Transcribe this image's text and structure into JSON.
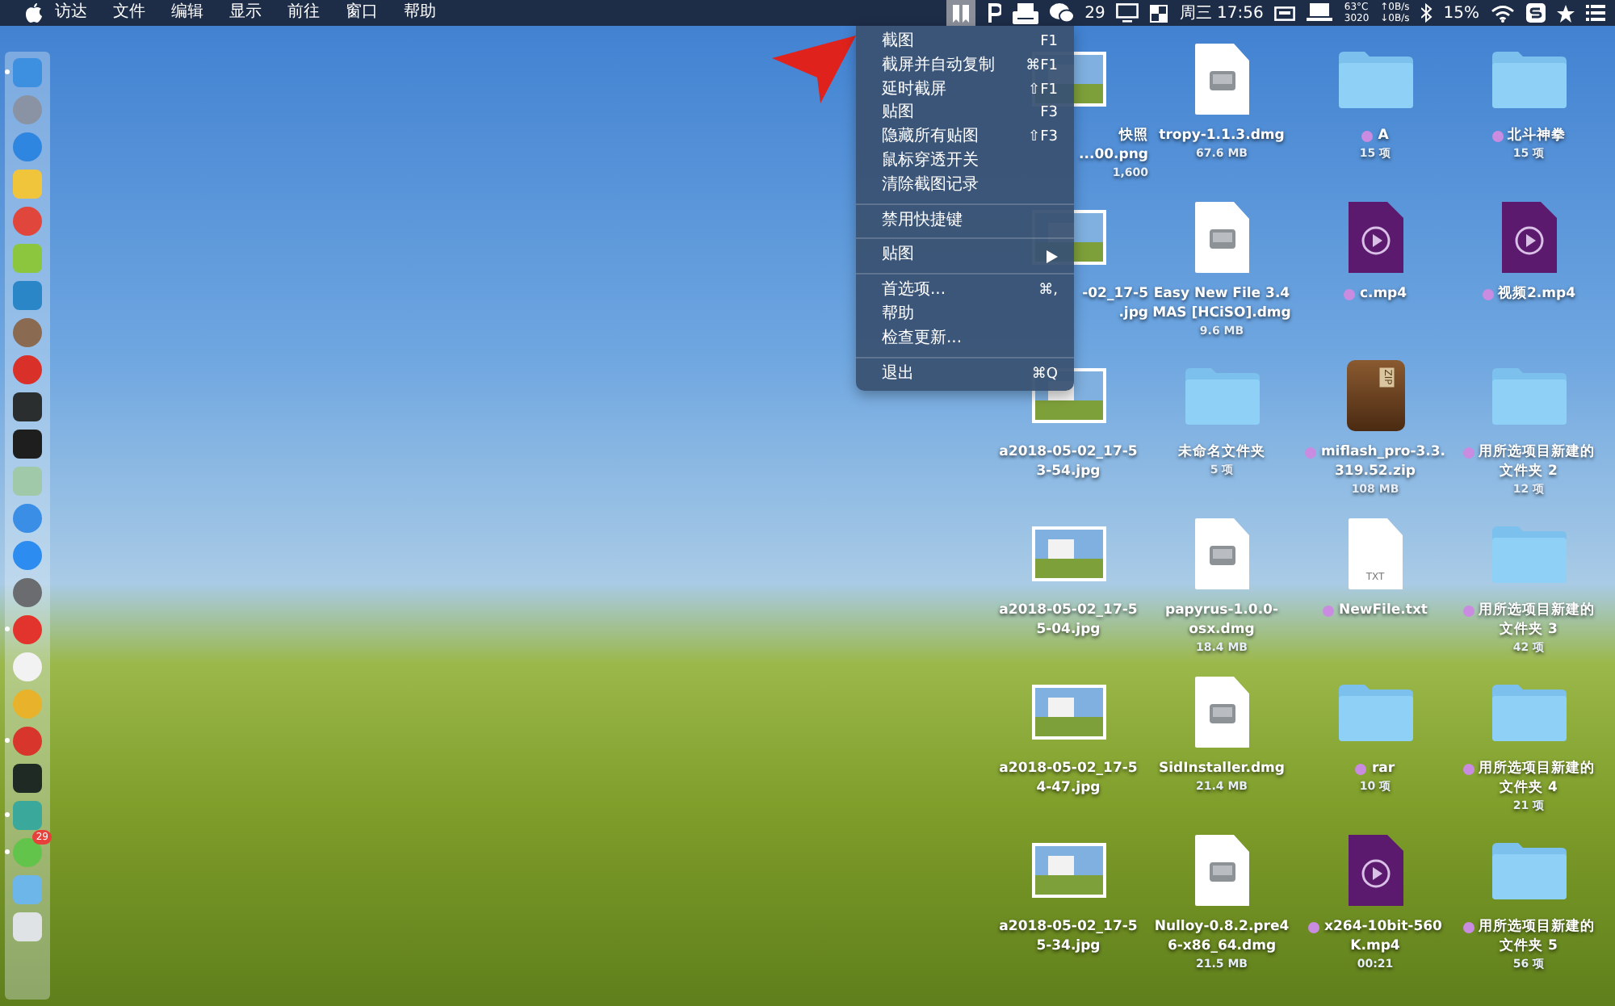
{
  "menubar": {
    "menus": [
      "访达",
      "文件",
      "编辑",
      "显示",
      "前往",
      "窗口",
      "帮助"
    ],
    "screenshot_extra_selected": true,
    "wechat_count": "29",
    "clock": "周三 17:56",
    "sensors": [
      "63°C",
      "3020"
    ],
    "network": [
      "↑0B/s",
      "↓0B/s"
    ],
    "battery": "15%"
  },
  "menu": {
    "sections": [
      [
        {
          "label": "截图",
          "shortcut": "F1",
          "submenu": false
        },
        {
          "label": "截屏并自动复制",
          "shortcut": "⌘F1",
          "submenu": false
        },
        {
          "label": "延时截屏",
          "shortcut": "⇧F1",
          "submenu": false
        },
        {
          "label": "贴图",
          "shortcut": "F3",
          "submenu": false
        },
        {
          "label": "隐藏所有贴图",
          "shortcut": "⇧F3",
          "submenu": false
        },
        {
          "label": "鼠标穿透开关",
          "submenu": false
        },
        {
          "label": "清除截图记录",
          "submenu": false
        }
      ],
      [
        {
          "label": "禁用快捷键",
          "submenu": false
        }
      ],
      [
        {
          "label": "贴图",
          "submenu": true
        }
      ],
      [
        {
          "label": "首选项...",
          "shortcut": "⌘,",
          "submenu": false
        },
        {
          "label": "帮助",
          "submenu": false
        },
        {
          "label": "检查更新...",
          "submenu": false
        }
      ],
      [
        {
          "label": "退出",
          "shortcut": "⌘Q",
          "submenu": false
        }
      ]
    ]
  },
  "dock": [
    {
      "kind": "square",
      "color": "#3d8fe0",
      "running": true
    },
    {
      "kind": "circle",
      "color": "#8a93a3",
      "running": false
    },
    {
      "kind": "circle",
      "color": "#2f86e0",
      "running": false
    },
    {
      "kind": "square",
      "color": "#f0c53c",
      "running": false
    },
    {
      "kind": "circle",
      "color": "#e0463c",
      "running": false
    },
    {
      "kind": "square",
      "color": "#8cc63f",
      "running": false
    },
    {
      "kind": "square",
      "color": "#2b86c8",
      "running": false
    },
    {
      "kind": "circle",
      "color": "#8a6a50",
      "running": false
    },
    {
      "kind": "circle",
      "color": "#d9302a",
      "running": false
    },
    {
      "kind": "square",
      "color": "#2a2e2e",
      "running": false
    },
    {
      "kind": "square",
      "color": "#1e1e1e",
      "running": false
    },
    {
      "kind": "square",
      "color": "#9fc9a8",
      "running": false
    },
    {
      "kind": "circle",
      "color": "#3a8ee6",
      "running": false
    },
    {
      "kind": "circle",
      "color": "#2d8cf0",
      "running": false
    },
    {
      "kind": "circle",
      "color": "#6a6c70",
      "running": false
    },
    {
      "kind": "circle",
      "color": "#e2342c",
      "running": true
    },
    {
      "kind": "circle",
      "color": "#f2f2f2",
      "running": false
    },
    {
      "kind": "circle",
      "color": "#e8b32a",
      "running": false
    },
    {
      "kind": "circle",
      "color": "#d8352c",
      "running": true
    },
    {
      "kind": "square",
      "color": "#1f2a24",
      "running": false
    },
    {
      "kind": "square",
      "color": "#3aa89a",
      "running": true
    },
    {
      "kind": "circle",
      "color": "#62c44a",
      "running": true,
      "badge": "29"
    },
    {
      "kind": "square",
      "color": "#6db6ea",
      "running": false
    },
    {
      "kind": "square",
      "color": "#dfe3e6",
      "running": false
    }
  ],
  "desktop_items": [
    {
      "kind": "partial_image",
      "lines": [
        "快照",
        "...00.png"
      ],
      "meta": "1,600",
      "tagged": false
    },
    {
      "kind": "dmg",
      "lines": [
        "tropy-1.1.3.dmg"
      ],
      "meta": "67.6 MB",
      "tagged": false
    },
    {
      "kind": "folder",
      "lines": [
        "A"
      ],
      "meta": "15 项",
      "tagged": true
    },
    {
      "kind": "folder",
      "lines": [
        "北斗神拳"
      ],
      "meta": "15 项",
      "tagged": true
    },
    {
      "kind": "partial_image",
      "lines": [
        "-02_17-5",
        ".jpg"
      ],
      "tagged": false
    },
    {
      "kind": "dmg",
      "lines": [
        "Easy New File 3.4",
        "MAS [HCiSO].dmg"
      ],
      "meta": "9.6 MB",
      "tagged": false
    },
    {
      "kind": "video",
      "lines": [
        "c.mp4"
      ],
      "tagged": true
    },
    {
      "kind": "video",
      "lines": [
        "视频2.mp4"
      ],
      "tagged": true
    },
    {
      "kind": "image",
      "lines": [
        "a2018-05-02_17-5",
        "3-54.jpg"
      ],
      "tagged": false
    },
    {
      "kind": "folder",
      "lines": [
        "未命名文件夹"
      ],
      "meta": "5 项",
      "tagged": false
    },
    {
      "kind": "zip",
      "lines": [
        "miflash_pro-3.3.",
        "319.52.zip"
      ],
      "meta": "108 MB",
      "badge": "ZIP",
      "tagged": true
    },
    {
      "kind": "folder",
      "lines": [
        "用所选项目新建的",
        "文件夹 2"
      ],
      "meta": "12 项",
      "tagged": true
    },
    {
      "kind": "image",
      "lines": [
        "a2018-05-02_17-5",
        "5-04.jpg"
      ],
      "tagged": false
    },
    {
      "kind": "dmg",
      "lines": [
        "papyrus-1.0.0-",
        "osx.dmg"
      ],
      "meta": "18.4 MB",
      "tagged": false
    },
    {
      "kind": "txt",
      "lines": [
        "NewFile.txt"
      ],
      "badge": "TXT",
      "tagged": true
    },
    {
      "kind": "folder",
      "lines": [
        "用所选项目新建的",
        "文件夹 3"
      ],
      "meta": "42 项",
      "tagged": true
    },
    {
      "kind": "image",
      "lines": [
        "a2018-05-02_17-5",
        "4-47.jpg"
      ],
      "tagged": false
    },
    {
      "kind": "dmg",
      "lines": [
        "SidInstaller.dmg"
      ],
      "meta": "21.4 MB",
      "tagged": false
    },
    {
      "kind": "folder",
      "lines": [
        "rar"
      ],
      "meta": "10 项",
      "tagged": true
    },
    {
      "kind": "folder",
      "lines": [
        "用所选项目新建的",
        "文件夹 4"
      ],
      "meta": "21 项",
      "tagged": true
    },
    {
      "kind": "image",
      "lines": [
        "a2018-05-02_17-5",
        "5-34.jpg"
      ],
      "tagged": false
    },
    {
      "kind": "dmg",
      "lines": [
        "Nulloy-0.8.2.pre4",
        "6-x86_64.dmg"
      ],
      "meta": "21.5 MB",
      "tagged": false
    },
    {
      "kind": "video",
      "lines": [
        "x264-10bit-560",
        "K.mp4"
      ],
      "meta": "00:21",
      "tagged": true
    },
    {
      "kind": "folder",
      "lines": [
        "用所选项目新建的",
        "文件夹 5"
      ],
      "meta": "56 项",
      "tagged": true
    }
  ]
}
